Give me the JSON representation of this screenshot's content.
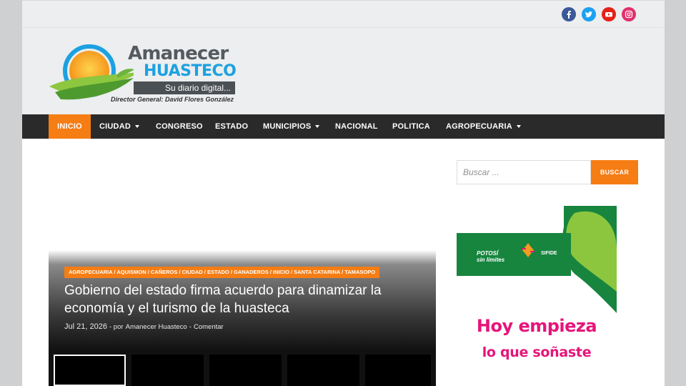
{
  "social": {
    "items": [
      {
        "name": "facebook-icon",
        "color": "#3b5998"
      },
      {
        "name": "twitter-icon",
        "color": "#1da1f2"
      },
      {
        "name": "youtube-icon",
        "color": "#e62117"
      },
      {
        "name": "instagram-icon",
        "color": "#e1306c"
      }
    ]
  },
  "logo": {
    "title": "Amanecer",
    "subtitle": "HUASTECO",
    "tagline": "Su diario digital...",
    "director": "Director General: David Flores González"
  },
  "nav": {
    "items": [
      {
        "label": "INICIO",
        "active": true,
        "dropdown": false
      },
      {
        "label": "CIUDAD",
        "active": false,
        "dropdown": true
      },
      {
        "label": "CONGRESO",
        "active": false,
        "dropdown": false
      },
      {
        "label": "ESTADO",
        "active": false,
        "dropdown": false
      },
      {
        "label": "MUNICIPIOS",
        "active": false,
        "dropdown": true
      },
      {
        "label": "NACIONAL",
        "active": false,
        "dropdown": false
      },
      {
        "label": "POLITICA",
        "active": false,
        "dropdown": false
      },
      {
        "label": "AGROPECUARIA",
        "active": false,
        "dropdown": true
      }
    ]
  },
  "feature": {
    "categories": "AGROPECUARIA / AQUISMON / CAÑEROS / CIUDAD / ESTADO / GANADEROS / INICIO / SANTA CATARINA / TAMASOPO",
    "headline": "Gobierno del estado firma acuerdo para dinamizar la economía y el turismo de la huasteca",
    "date": "Jul 21, 2026",
    "author_prefix": "- por",
    "author": "Amanecer Huasteco",
    "comment_sep": "-",
    "comment": "Comentar"
  },
  "search": {
    "placeholder": "Buscar ...",
    "button": "BUSCAR"
  },
  "ad": {
    "brand_line1": "POTOSÍ",
    "brand_line2": "sin límites",
    "sifide": "SIFIDE",
    "line1": "Hoy empieza",
    "line2": "lo que soñaste",
    "accent_green": "#17853e",
    "accent_pink": "#e6147a"
  },
  "colors": {
    "accent": "#f57d14",
    "nav_bg": "#2a2a2a",
    "header_bg": "#eceeef"
  }
}
